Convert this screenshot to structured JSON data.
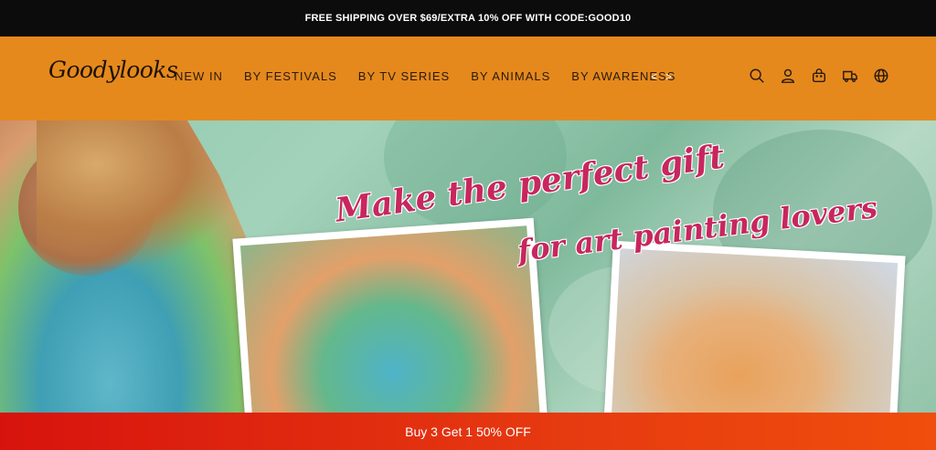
{
  "announcement": "FREE SHIPPING OVER $69/EXTRA 10% OFF WITH CODE:GOOD10",
  "header": {
    "logo": "Goodylooks",
    "nav": [
      "NEW IN",
      "BY FESTIVALS",
      "BY TV SERIES",
      "BY ANIMALS",
      "BY AWARENESS"
    ],
    "prev_arrow": "<",
    "next_arrow": ">",
    "icons": [
      "search-icon",
      "account-icon",
      "cart-icon",
      "shipping-truck-icon",
      "globe-icon"
    ]
  },
  "hero": {
    "headline_line1": "Make the perfect gift",
    "headline_line2": "for art painting lovers"
  },
  "promo_bar": "Buy 3 Get 1 50% OFF",
  "colors": {
    "announcement_bg": "#0c0c0c",
    "header_bg": "#e5891d",
    "headline": "#c8265f",
    "promo_bg": "#e63a10"
  }
}
